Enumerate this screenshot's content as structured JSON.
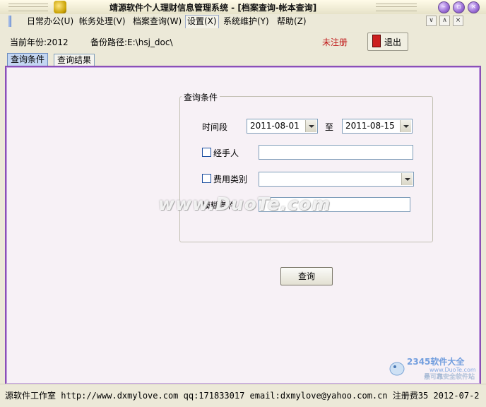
{
  "window": {
    "title": "靖源软件个人理财信息管理系统 - [档案查询-帐本查询]",
    "controls": [
      "minimize-icon",
      "restore-icon",
      "close-icon"
    ]
  },
  "menubar": {
    "items": [
      {
        "label": "日常办公(U)"
      },
      {
        "label": "帐务处理(V)"
      },
      {
        "label": "档案查询(W)"
      },
      {
        "label": "设置(X)"
      },
      {
        "label": "系统维护(Y)"
      },
      {
        "label": "帮助(Z)"
      }
    ],
    "mdi_controls": [
      "∨",
      "∧",
      "×"
    ]
  },
  "info": {
    "year_label": "当前年份:2012",
    "backup_label": "备份路径:E:\\hsj_doc\\",
    "registration": "未注册",
    "exit_label": "退出"
  },
  "tabs": [
    {
      "label": "查询条件",
      "active": true
    },
    {
      "label": "查询结果",
      "active": false
    }
  ],
  "query": {
    "group_title": "查询条件",
    "period_label": "时间段",
    "date_from": "2011-08-01",
    "to_label": "至",
    "date_to": "2011-08-15",
    "handler_label": "经手人",
    "handler_value": "",
    "expense_type_label": "费用类别",
    "expense_type_value": "",
    "fuzzy_label": "模糊条件",
    "fuzzy_value": "",
    "query_button": "查询"
  },
  "watermark": "www.DuoTe.com",
  "logo": {
    "brand": "2345软件大全",
    "url": "www.DuoTe.com",
    "tagline": "最可靠安全软件站"
  },
  "status": "源软件工作室 http://www.dxmylove.com qq:171833017 email:dxmylove@yahoo.com.cn 注册费35 2012-07-2"
}
